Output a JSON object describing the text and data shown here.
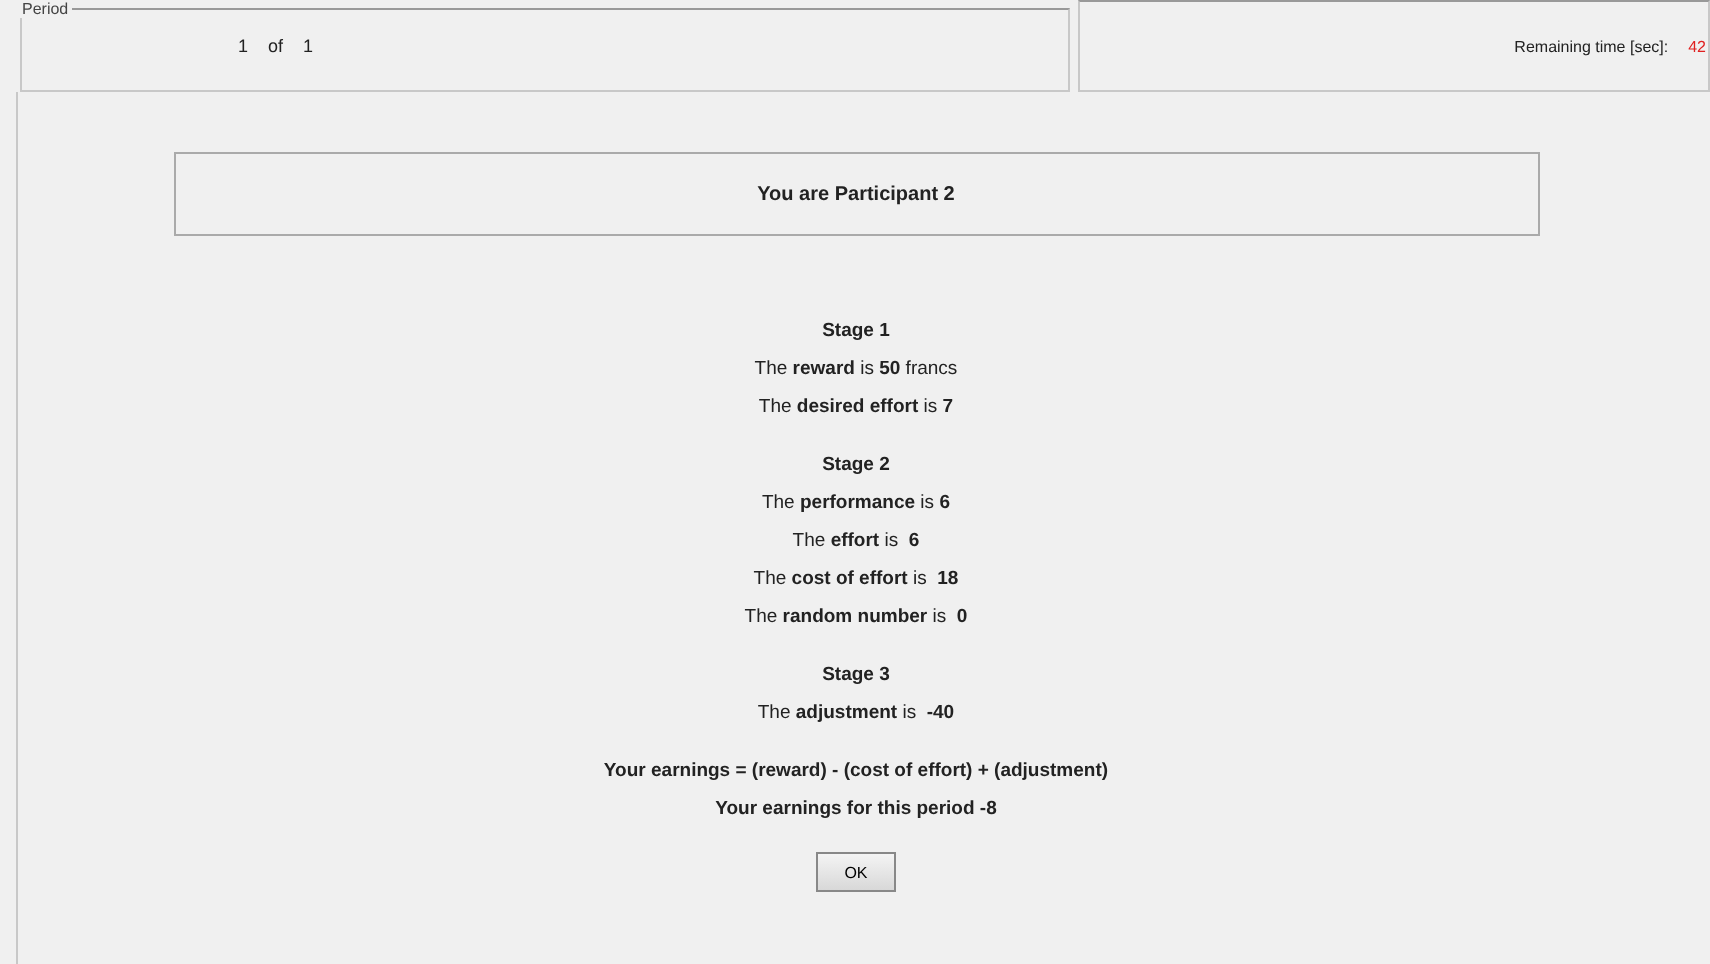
{
  "period": {
    "legend": "Period",
    "current": "1",
    "of": "of",
    "total": "1"
  },
  "timer": {
    "label": "Remaining time [sec]:",
    "value": "42"
  },
  "participant": "You are Participant 2",
  "stages": [
    {
      "title": "Stage 1",
      "lines": [
        "The **reward** is **50** francs",
        "The **desired effort** is **7**"
      ]
    },
    {
      "title": "Stage 2",
      "lines": [
        "The **performance** is **6**",
        "The **effort** is  **6**",
        "The **cost of effort** is  **18**",
        "The **random number** is  **0**"
      ]
    },
    {
      "title": "Stage 3",
      "lines": [
        "The **adjustment** is  **-40**"
      ]
    }
  ],
  "summary": [
    "Your earnings = (reward) - (cost of effort) + (adjustment)",
    "Your earnings for this period -8"
  ],
  "ok_button": "OK"
}
